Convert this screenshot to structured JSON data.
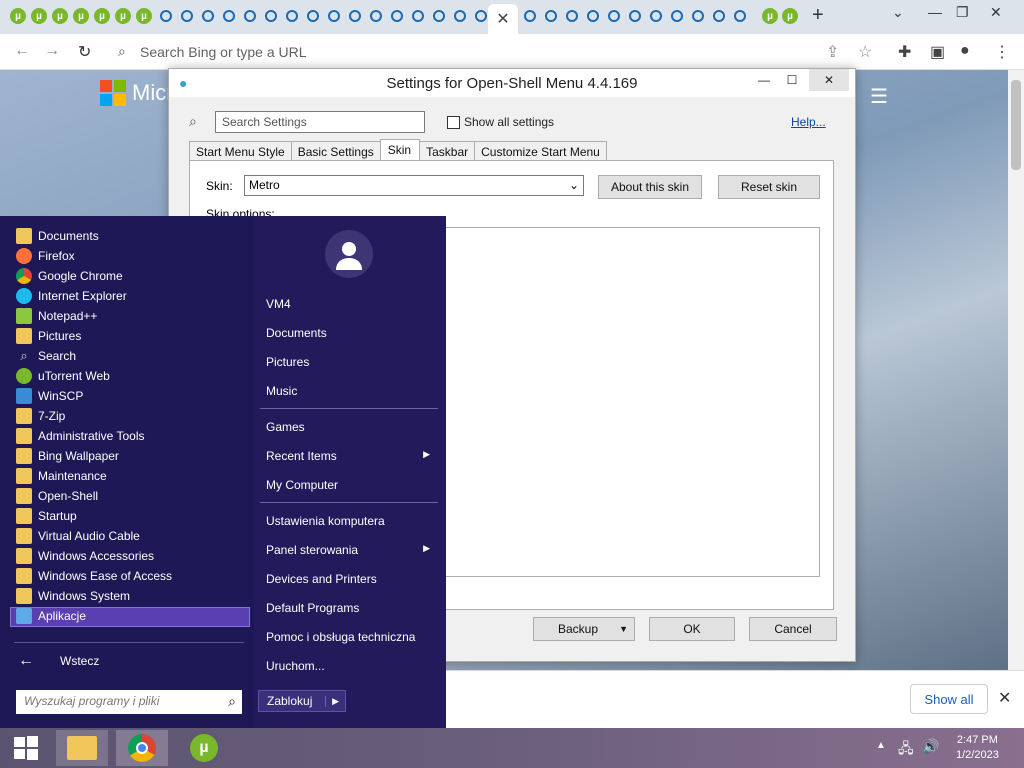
{
  "browser": {
    "active_tab_close": "✕",
    "new_tab": "+",
    "address_placeholder": "Search Bing or type a URL",
    "bg_logo_text": "Micr"
  },
  "page": {
    "show_all_label": "Show all",
    "close_label": "✕"
  },
  "dialog": {
    "title": "Settings for Open-Shell Menu 4.4.169",
    "search_placeholder": "Search Settings",
    "show_all_settings": "Show all settings",
    "help": "Help...",
    "tabs": [
      "Start Menu Style",
      "Basic Settings",
      "Skin",
      "Taskbar",
      "Customize Start Menu"
    ],
    "active_tab": "Skin",
    "skin_label": "Skin:",
    "skin_value": "Metro",
    "about_skin": "About this skin",
    "reset_skin": "Reset skin",
    "skin_options": "Skin options:",
    "backup": "Backup",
    "ok": "OK",
    "cancel": "Cancel"
  },
  "start_menu": {
    "programs": [
      {
        "label": "Documents",
        "icon": "folder-icon"
      },
      {
        "label": "Firefox",
        "icon": "firefox-icon"
      },
      {
        "label": "Google Chrome",
        "icon": "chrome-icon"
      },
      {
        "label": "Internet Explorer",
        "icon": "ie-icon"
      },
      {
        "label": "Notepad++",
        "icon": "notepad-icon"
      },
      {
        "label": "Pictures",
        "icon": "folder-icon"
      },
      {
        "label": "Search",
        "icon": "search-icon"
      },
      {
        "label": "uTorrent Web",
        "icon": "utorrent-icon"
      },
      {
        "label": "WinSCP",
        "icon": "winscp-icon"
      },
      {
        "label": "7-Zip",
        "icon": "folder-icon"
      },
      {
        "label": "Administrative Tools",
        "icon": "folder-icon"
      },
      {
        "label": "Bing Wallpaper",
        "icon": "folder-icon"
      },
      {
        "label": "Maintenance",
        "icon": "folder-icon"
      },
      {
        "label": "Open-Shell",
        "icon": "folder-icon"
      },
      {
        "label": "Startup",
        "icon": "folder-icon"
      },
      {
        "label": "Virtual Audio Cable",
        "icon": "folder-icon"
      },
      {
        "label": "Windows Accessories",
        "icon": "folder-icon"
      },
      {
        "label": "Windows Ease of Access",
        "icon": "folder-icon"
      },
      {
        "label": "Windows System",
        "icon": "folder-icon"
      },
      {
        "label": "Aplikacje",
        "icon": "apps-icon"
      }
    ],
    "back": "Wstecz",
    "search_placeholder": "Wyszukaj programy i pliki",
    "right_items": {
      "user": "VM4",
      "documents": "Documents",
      "pictures": "Pictures",
      "music": "Music",
      "games": "Games",
      "recent": "Recent Items",
      "computer": "My Computer",
      "settings": "Ustawienia komputera",
      "control": "Panel sterowania",
      "devices": "Devices and Printers",
      "defaults": "Default Programs",
      "help": "Pomoc i obsługa techniczna",
      "run": "Uruchom..."
    },
    "lock": "Zablokuj"
  },
  "taskbar": {
    "time": "2:47 PM",
    "date": "1/2/2023"
  }
}
